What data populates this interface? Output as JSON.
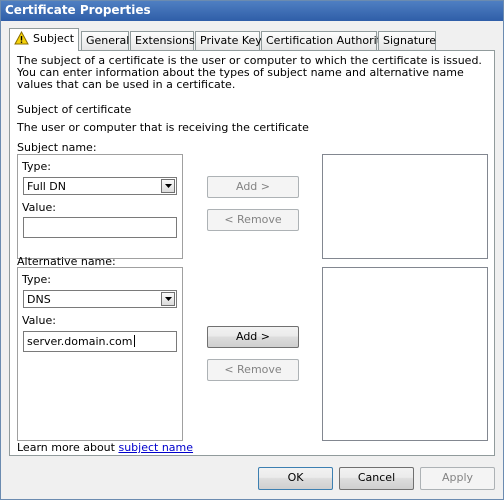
{
  "window": {
    "title": "Certificate Properties"
  },
  "tabs": [
    {
      "label": "Subject",
      "active": true,
      "icon": "warning-icon"
    },
    {
      "label": "General"
    },
    {
      "label": "Extensions"
    },
    {
      "label": "Private Key"
    },
    {
      "label": "Certification Authority"
    },
    {
      "label": "Signature"
    }
  ],
  "subject_tab": {
    "description": "The subject of a certificate is the user or computer to which the certificate is issued. You can enter information about the types of subject name and alternative name values that can be used in a certificate.",
    "section_title": "Subject of certificate",
    "section_desc": "The user or computer that is receiving the certificate",
    "subject_name": {
      "label": "Subject name:",
      "type_label": "Type:",
      "type_value": "Full DN",
      "value_label": "Value:",
      "value": "",
      "add_button": "Add >",
      "remove_button": "< Remove"
    },
    "alternative_name": {
      "label": "Alternative name:",
      "type_label": "Type:",
      "type_value": "DNS",
      "value_label": "Value:",
      "value": "server.domain.com",
      "add_button": "Add >",
      "remove_button": "< Remove"
    },
    "learn_more_prefix": "Learn more about ",
    "learn_more_link": "subject name"
  },
  "footer": {
    "ok": "OK",
    "cancel": "Cancel",
    "apply": "Apply"
  },
  "colors": {
    "title_bar": "#3a6ab5",
    "link": "#0000cc",
    "disabled_text": "#838383"
  }
}
